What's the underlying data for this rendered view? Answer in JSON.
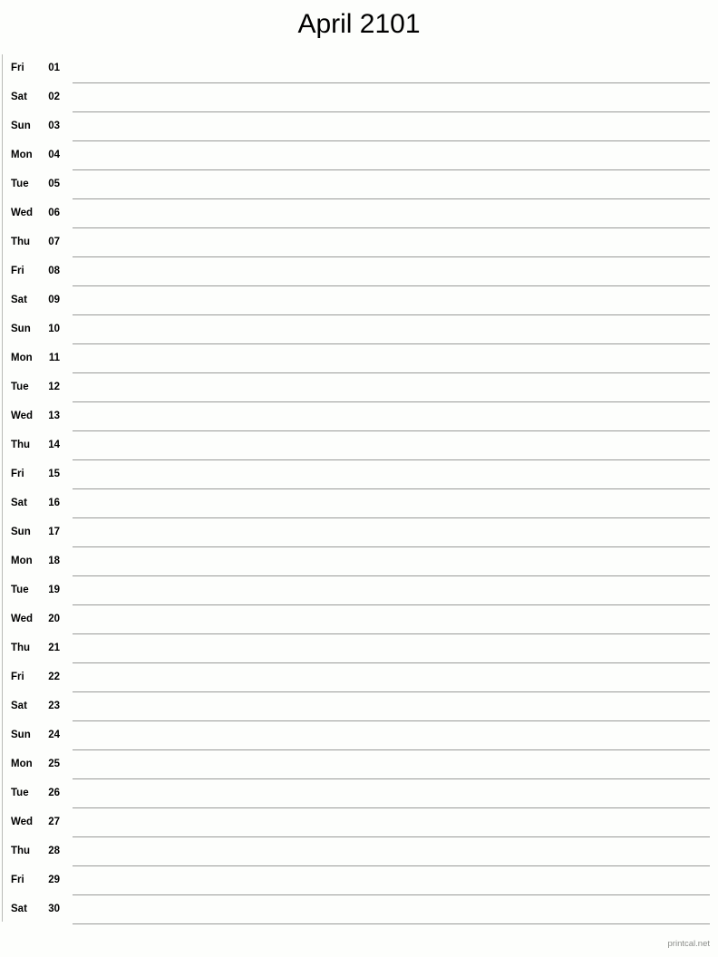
{
  "document": {
    "title": "April 2101",
    "month": "April",
    "year": "2101",
    "type": "printable-notes-calendar",
    "line_color": "#999b98",
    "text_color": "#000000",
    "background_color": "#fdfefc",
    "footer_color": "#8b8d8a"
  },
  "footer": {
    "credit": "printcal.net"
  },
  "days": [
    {
      "weekday": "Fri",
      "number": "01"
    },
    {
      "weekday": "Sat",
      "number": "02"
    },
    {
      "weekday": "Sun",
      "number": "03"
    },
    {
      "weekday": "Mon",
      "number": "04"
    },
    {
      "weekday": "Tue",
      "number": "05"
    },
    {
      "weekday": "Wed",
      "number": "06"
    },
    {
      "weekday": "Thu",
      "number": "07"
    },
    {
      "weekday": "Fri",
      "number": "08"
    },
    {
      "weekday": "Sat",
      "number": "09"
    },
    {
      "weekday": "Sun",
      "number": "10"
    },
    {
      "weekday": "Mon",
      "number": "11"
    },
    {
      "weekday": "Tue",
      "number": "12"
    },
    {
      "weekday": "Wed",
      "number": "13"
    },
    {
      "weekday": "Thu",
      "number": "14"
    },
    {
      "weekday": "Fri",
      "number": "15"
    },
    {
      "weekday": "Sat",
      "number": "16"
    },
    {
      "weekday": "Sun",
      "number": "17"
    },
    {
      "weekday": "Mon",
      "number": "18"
    },
    {
      "weekday": "Tue",
      "number": "19"
    },
    {
      "weekday": "Wed",
      "number": "20"
    },
    {
      "weekday": "Thu",
      "number": "21"
    },
    {
      "weekday": "Fri",
      "number": "22"
    },
    {
      "weekday": "Sat",
      "number": "23"
    },
    {
      "weekday": "Sun",
      "number": "24"
    },
    {
      "weekday": "Mon",
      "number": "25"
    },
    {
      "weekday": "Tue",
      "number": "26"
    },
    {
      "weekday": "Wed",
      "number": "27"
    },
    {
      "weekday": "Thu",
      "number": "28"
    },
    {
      "weekday": "Fri",
      "number": "29"
    },
    {
      "weekday": "Sat",
      "number": "30"
    }
  ]
}
